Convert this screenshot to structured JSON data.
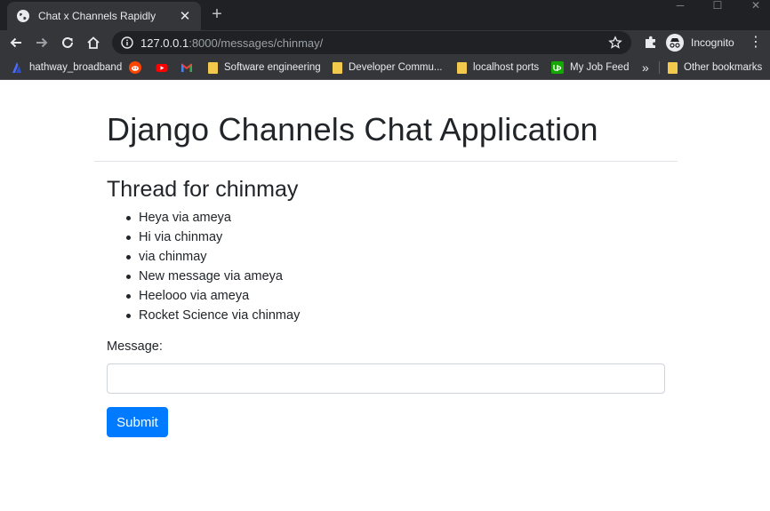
{
  "browser": {
    "tab_title": "Chat x Channels Rapidly",
    "tab_close": "✕",
    "new_tab": "+",
    "window_controls": {
      "minimize": "─",
      "maximize": "☐",
      "close": "✕"
    },
    "url": {
      "host": "127.0.0.1",
      "rest": ":8000/messages/chinmay/"
    },
    "profile_label": "Incognito",
    "menu_glyph": "⋮",
    "bookmarks": [
      {
        "label": "hathway_broadband",
        "icon": "hathway-icon"
      },
      {
        "label": "",
        "icon": "reddit-icon"
      },
      {
        "label": "",
        "icon": "youtube-icon"
      },
      {
        "label": "",
        "icon": "gmail-icon"
      },
      {
        "label": "Software engineering",
        "icon": "folder-icon"
      },
      {
        "label": "Developer Commu...",
        "icon": "folder-icon"
      },
      {
        "label": "localhost ports",
        "icon": "folder-icon"
      },
      {
        "label": "My Job Feed",
        "icon": "upwork-icon"
      }
    ],
    "bookmarks_overflow": "»",
    "other_bookmarks": "Other bookmarks"
  },
  "page": {
    "title": "Django Channels Chat Application",
    "thread_title": "Thread for chinmay",
    "messages": [
      "Heya via ameya",
      "Hi via chinmay",
      "via chinmay",
      "New message via ameya",
      "Heelooo via ameya",
      "Rocket Science via chinmay"
    ],
    "form": {
      "label": "Message:",
      "input_value": "",
      "submit_label": "Submit"
    }
  },
  "colors": {
    "accent": "#007bff",
    "chrome_dark": "#202124",
    "chrome_toolbar": "#35363a",
    "text": "#212529"
  }
}
